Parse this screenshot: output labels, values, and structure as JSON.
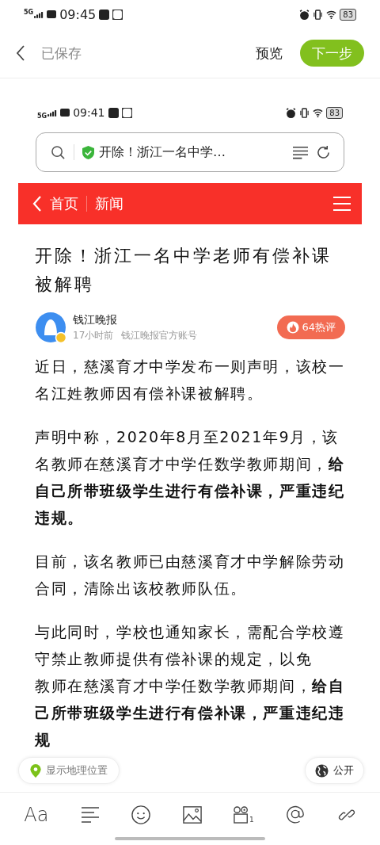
{
  "status_bar": {
    "network": "5G",
    "time": "09:45",
    "battery": "83"
  },
  "header": {
    "back_label": "已保存",
    "preview": "预览",
    "next": "下一步"
  },
  "shared_page": {
    "status_bar": {
      "network": "5G",
      "time": "09:41",
      "battery": "83"
    },
    "address_bar": {
      "title": "开除！浙江一名中学…",
      "secure": true
    },
    "nav": {
      "back": "首页",
      "section": "新闻"
    },
    "title": "开除！浙江一名中学老师有偿补课被解聘",
    "author": {
      "name": "钱江晚报",
      "time": "17小时前",
      "account": "钱江晚报官方账号",
      "verified": true,
      "hot_comments": "64热评"
    },
    "paragraphs": [
      "近日，慈溪育才中学发布一则声明，该校一名江姓教师因有偿补课被解聘。",
      "声明中称，2020年8月至2021年9月，该名教师在慈溪育才中学任数学教师期间，**给自己所带班级学生进行有偿补课，严重违纪违规。**",
      "目前，该名教师已由慈溪育才中学解除劳动合同，清除出该校教师队伍。",
      "与此同时，学校也通知家长，需配合学校遵守禁止教师提供有偿补课的规定，以免",
      "教师在慈溪育才中学任数学教师期间，**给自己所带班级学生进行有偿补课，严重违纪违规**"
    ]
  },
  "location_chip": "显示地理位置",
  "visibility_chip": "公开",
  "toolbar": [
    {
      "kind": "font",
      "label": "Aa"
    },
    {
      "kind": "align"
    },
    {
      "kind": "emoji"
    },
    {
      "kind": "image"
    },
    {
      "kind": "video",
      "label": "1"
    },
    {
      "kind": "mention"
    },
    {
      "kind": "link"
    }
  ]
}
